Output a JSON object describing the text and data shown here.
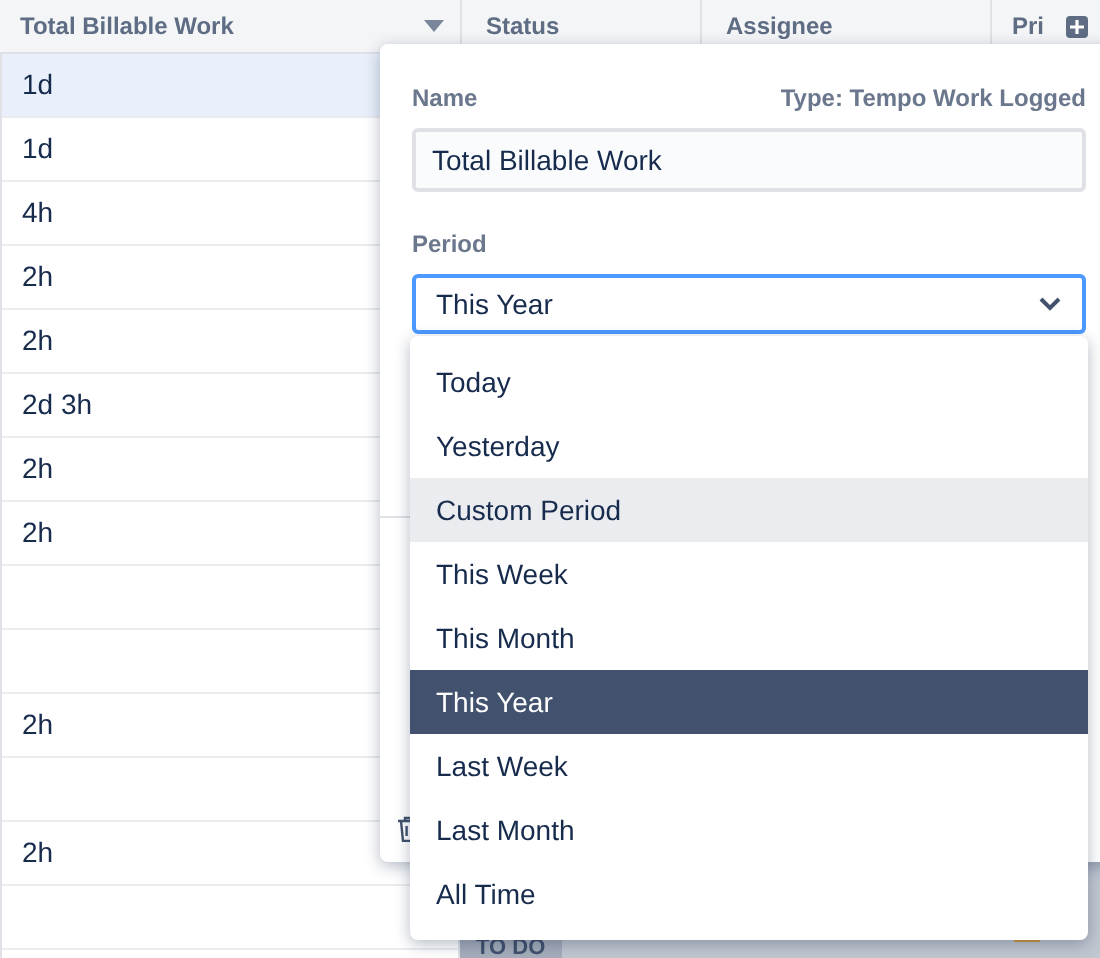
{
  "table": {
    "columns": [
      {
        "label": "Total Billable Work",
        "sorted": true
      },
      {
        "label": "Status"
      },
      {
        "label": "Assignee"
      },
      {
        "label": "Pri"
      }
    ],
    "rows": [
      {
        "value": "1d",
        "selected": true
      },
      {
        "value": "1d",
        "selected": false
      },
      {
        "value": "4h",
        "selected": false
      },
      {
        "value": "2h",
        "selected": false
      },
      {
        "value": "2h",
        "selected": false
      },
      {
        "value": "2d 3h",
        "selected": false
      },
      {
        "value": "2h",
        "selected": false
      },
      {
        "value": "2h",
        "selected": false
      },
      {
        "selected": false
      },
      {
        "selected": false
      },
      {
        "value": "2h",
        "selected": false
      },
      {
        "selected": false
      },
      {
        "value": "2h",
        "selected": false
      },
      {
        "selected": false
      }
    ],
    "bottom_row": {
      "status": "TO DO"
    }
  },
  "panel": {
    "name_label": "Name",
    "type_label": "Type: Tempo Work Logged",
    "name_value": "Total Billable Work",
    "period_label": "Period",
    "period_value": "This Year"
  },
  "period_menu": [
    {
      "label": "Today",
      "selected": false,
      "hovered": false
    },
    {
      "label": "Yesterday",
      "selected": false,
      "hovered": false
    },
    {
      "label": "Custom Period",
      "selected": false,
      "hovered": true
    },
    {
      "label": "This Week",
      "selected": false,
      "hovered": false
    },
    {
      "label": "This Month",
      "selected": false,
      "hovered": false
    },
    {
      "label": "This Year",
      "selected": true,
      "hovered": false
    },
    {
      "label": "Last Week",
      "selected": false,
      "hovered": false
    },
    {
      "label": "Last Month",
      "selected": false,
      "hovered": false
    },
    {
      "label": "All Time",
      "selected": false,
      "hovered": false
    }
  ]
}
